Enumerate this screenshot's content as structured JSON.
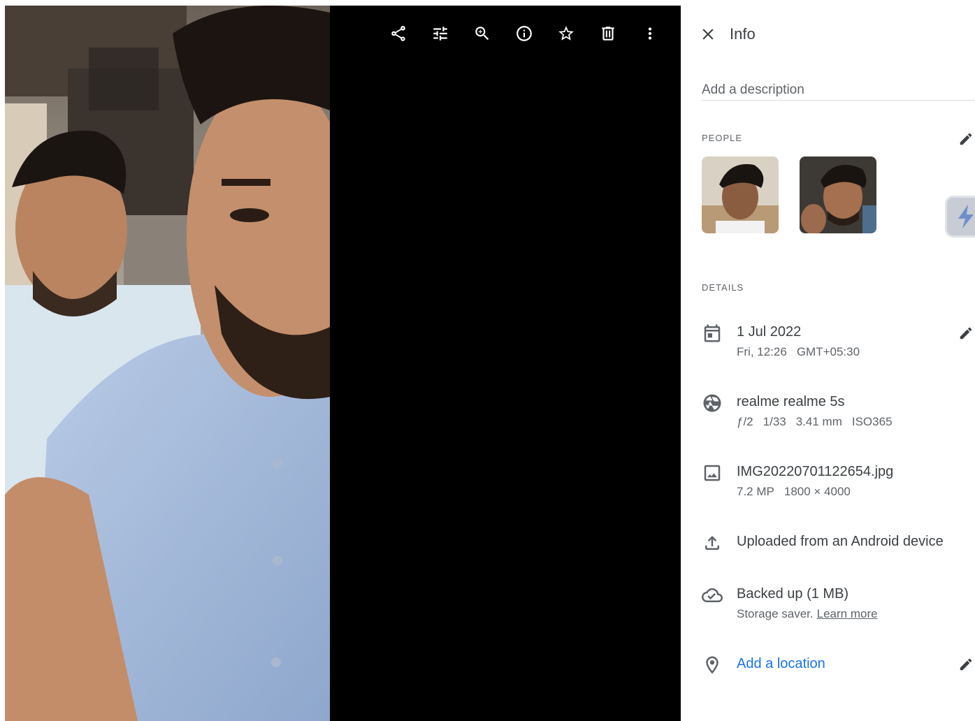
{
  "toolbar": {
    "icons": [
      "share-icon",
      "edit-tune-icon",
      "zoom-in-icon",
      "info-icon",
      "star-icon",
      "delete-icon",
      "more-vert-icon"
    ]
  },
  "panel": {
    "title": "Info",
    "description_placeholder": "Add a description",
    "people_label": "PEOPLE",
    "details_label": "DETAILS"
  },
  "details": {
    "date": {
      "primary": "1 Jul 2022",
      "time": "Fri, 12:26",
      "timezone": "GMT+05:30"
    },
    "camera": {
      "primary": "realme realme 5s",
      "aperture": "ƒ/2",
      "shutter": "1/33",
      "focal": "3.41 mm",
      "iso": "ISO365"
    },
    "file": {
      "primary": "IMG20220701122654.jpg",
      "megapixels": "7.2 MP",
      "resolution": "1800 × 4000"
    },
    "upload": {
      "primary": "Uploaded from an Android device"
    },
    "backup": {
      "primary": "Backed up (1 MB)",
      "storage": "Storage saver.",
      "learn_more": "Learn more"
    },
    "location": {
      "primary": "Add a location"
    }
  },
  "colors": {
    "accent": "#1a73e8",
    "text_primary": "#3c4043",
    "text_secondary": "#5f6368",
    "viewer_bg": "#000000"
  }
}
